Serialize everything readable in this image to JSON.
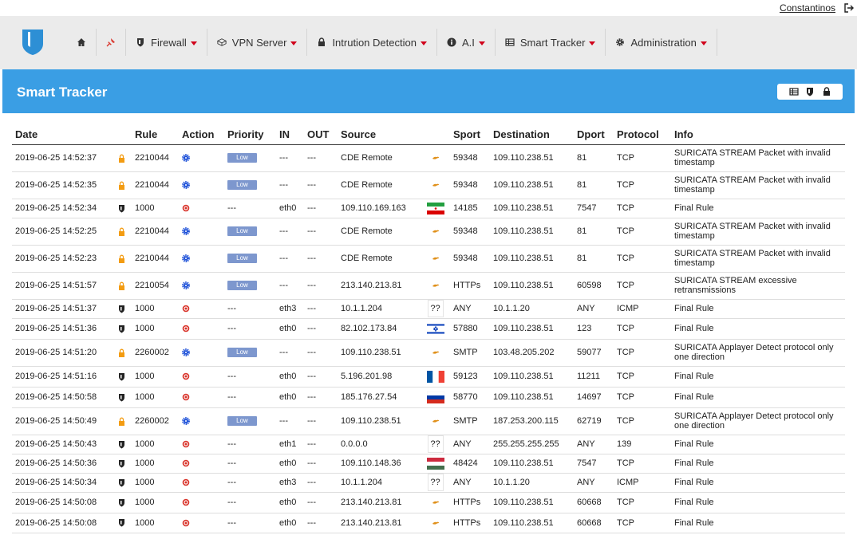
{
  "user": {
    "name": "Constantinos",
    "logout_icon": "sign-out-icon"
  },
  "brand": {
    "icon": "shield-logo",
    "color": "#2d8fd5"
  },
  "nav": [
    {
      "key": "home",
      "label": "",
      "icon": "home-icon",
      "caret": false
    },
    {
      "key": "tools",
      "label": "",
      "icon": "pin-icon",
      "caret": false
    },
    {
      "key": "firewall",
      "label": "Firewall",
      "icon": "shield-icon",
      "caret": true
    },
    {
      "key": "vpn",
      "label": "VPN Server",
      "icon": "cube-icon",
      "caret": true
    },
    {
      "key": "ids",
      "label": "Intrution Detection",
      "icon": "lock-icon",
      "caret": true
    },
    {
      "key": "ai",
      "label": "A.I",
      "icon": "info-icon",
      "caret": true
    },
    {
      "key": "smart",
      "label": "Smart Tracker",
      "icon": "table-icon",
      "caret": true
    },
    {
      "key": "admin",
      "label": "Administration",
      "icon": "gear-icon",
      "caret": true
    }
  ],
  "panel": {
    "title": "Smart Tracker",
    "accent": "#3a9ee4",
    "tools": [
      "table-icon",
      "shield-icon",
      "lock-icon"
    ]
  },
  "columns": [
    "Date",
    "",
    "Rule",
    "Action",
    "Priority",
    "IN",
    "OUT",
    "Source",
    "",
    "Sport",
    "Destination",
    "Dport",
    "Protocol",
    "Info"
  ],
  "rows": [
    {
      "date": "2019-06-25 14:52:37",
      "rtype": "lock",
      "rule": "2210044",
      "action": "alert",
      "priority": "Low",
      "in": "---",
      "out": "---",
      "source": "CDE Remote",
      "flag": "cy",
      "sport": "59348",
      "dest": "109.110.238.51",
      "dport": "81",
      "proto": "TCP",
      "info": "SURICATA STREAM Packet with invalid timestamp"
    },
    {
      "date": "2019-06-25 14:52:35",
      "rtype": "lock",
      "rule": "2210044",
      "action": "alert",
      "priority": "Low",
      "in": "---",
      "out": "---",
      "source": "CDE Remote",
      "flag": "cy",
      "sport": "59348",
      "dest": "109.110.238.51",
      "dport": "81",
      "proto": "TCP",
      "info": "SURICATA STREAM Packet with invalid timestamp"
    },
    {
      "date": "2019-06-25 14:52:34",
      "rtype": "shield",
      "rule": "1000",
      "action": "block",
      "priority": "---",
      "in": "eth0",
      "out": "---",
      "source": "109.110.169.163",
      "flag": "ir",
      "sport": "14185",
      "dest": "109.110.238.51",
      "dport": "7547",
      "proto": "TCP",
      "info": "Final Rule"
    },
    {
      "date": "2019-06-25 14:52:25",
      "rtype": "lock",
      "rule": "2210044",
      "action": "alert",
      "priority": "Low",
      "in": "---",
      "out": "---",
      "source": "CDE Remote",
      "flag": "cy",
      "sport": "59348",
      "dest": "109.110.238.51",
      "dport": "81",
      "proto": "TCP",
      "info": "SURICATA STREAM Packet with invalid timestamp"
    },
    {
      "date": "2019-06-25 14:52:23",
      "rtype": "lock",
      "rule": "2210044",
      "action": "alert",
      "priority": "Low",
      "in": "---",
      "out": "---",
      "source": "CDE Remote",
      "flag": "cy",
      "sport": "59348",
      "dest": "109.110.238.51",
      "dport": "81",
      "proto": "TCP",
      "info": "SURICATA STREAM Packet with invalid timestamp"
    },
    {
      "date": "2019-06-25 14:51:57",
      "rtype": "lock",
      "rule": "2210054",
      "action": "alert",
      "priority": "Low",
      "in": "---",
      "out": "---",
      "source": "213.140.213.81",
      "flag": "cy",
      "sport": "HTTPs",
      "dest": "109.110.238.51",
      "dport": "60598",
      "proto": "TCP",
      "info": "SURICATA STREAM excessive retransmissions"
    },
    {
      "date": "2019-06-25 14:51:37",
      "rtype": "shield",
      "rule": "1000",
      "action": "block",
      "priority": "---",
      "in": "eth3",
      "out": "---",
      "source": "10.1.1.204",
      "flag": "unknown",
      "sport": "ANY",
      "dest": "10.1.1.20",
      "dport": "ANY",
      "proto": "ICMP",
      "info": "Final Rule"
    },
    {
      "date": "2019-06-25 14:51:36",
      "rtype": "shield",
      "rule": "1000",
      "action": "block",
      "priority": "---",
      "in": "eth0",
      "out": "---",
      "source": "82.102.173.84",
      "flag": "il",
      "sport": "57880",
      "dest": "109.110.238.51",
      "dport": "123",
      "proto": "TCP",
      "info": "Final Rule"
    },
    {
      "date": "2019-06-25 14:51:20",
      "rtype": "lock",
      "rule": "2260002",
      "action": "alert",
      "priority": "Low",
      "in": "---",
      "out": "---",
      "source": "109.110.238.51",
      "flag": "cy",
      "sport": "SMTP",
      "dest": "103.48.205.202",
      "dport": "59077",
      "proto": "TCP",
      "info": "SURICATA Applayer Detect protocol only one direction"
    },
    {
      "date": "2019-06-25 14:51:16",
      "rtype": "shield",
      "rule": "1000",
      "action": "block",
      "priority": "---",
      "in": "eth0",
      "out": "---",
      "source": "5.196.201.98",
      "flag": "fr",
      "sport": "59123",
      "dest": "109.110.238.51",
      "dport": "11211",
      "proto": "TCP",
      "info": "Final Rule"
    },
    {
      "date": "2019-06-25 14:50:58",
      "rtype": "shield",
      "rule": "1000",
      "action": "block",
      "priority": "---",
      "in": "eth0",
      "out": "---",
      "source": "185.176.27.54",
      "flag": "ru",
      "sport": "58770",
      "dest": "109.110.238.51",
      "dport": "14697",
      "proto": "TCP",
      "info": "Final Rule"
    },
    {
      "date": "2019-06-25 14:50:49",
      "rtype": "lock",
      "rule": "2260002",
      "action": "alert",
      "priority": "Low",
      "in": "---",
      "out": "---",
      "source": "109.110.238.51",
      "flag": "cy",
      "sport": "SMTP",
      "dest": "187.253.200.115",
      "dport": "62719",
      "proto": "TCP",
      "info": "SURICATA Applayer Detect protocol only one direction"
    },
    {
      "date": "2019-06-25 14:50:43",
      "rtype": "shield",
      "rule": "1000",
      "action": "block",
      "priority": "---",
      "in": "eth1",
      "out": "---",
      "source": "0.0.0.0",
      "flag": "unknown",
      "sport": "ANY",
      "dest": "255.255.255.255",
      "dport": "ANY",
      "proto": "139",
      "info": "Final Rule"
    },
    {
      "date": "2019-06-25 14:50:36",
      "rtype": "shield",
      "rule": "1000",
      "action": "block",
      "priority": "---",
      "in": "eth0",
      "out": "---",
      "source": "109.110.148.36",
      "flag": "hu",
      "sport": "48424",
      "dest": "109.110.238.51",
      "dport": "7547",
      "proto": "TCP",
      "info": "Final Rule"
    },
    {
      "date": "2019-06-25 14:50:34",
      "rtype": "shield",
      "rule": "1000",
      "action": "block",
      "priority": "---",
      "in": "eth3",
      "out": "---",
      "source": "10.1.1.204",
      "flag": "unknown",
      "sport": "ANY",
      "dest": "10.1.1.20",
      "dport": "ANY",
      "proto": "ICMP",
      "info": "Final Rule"
    },
    {
      "date": "2019-06-25 14:50:08",
      "rtype": "shield",
      "rule": "1000",
      "action": "block",
      "priority": "---",
      "in": "eth0",
      "out": "---",
      "source": "213.140.213.81",
      "flag": "cy",
      "sport": "HTTPs",
      "dest": "109.110.238.51",
      "dport": "60668",
      "proto": "TCP",
      "info": "Final Rule"
    },
    {
      "date": "2019-06-25 14:50:08",
      "rtype": "shield",
      "rule": "1000",
      "action": "block",
      "priority": "---",
      "in": "eth0",
      "out": "---",
      "source": "213.140.213.81",
      "flag": "cy",
      "sport": "HTTPs",
      "dest": "109.110.238.51",
      "dport": "60668",
      "proto": "TCP",
      "info": "Final Rule"
    }
  ],
  "unknown_flag_text": "??",
  "colors": {
    "alert": "#1b4fd8",
    "block": "#d9342b",
    "lock": "#f39c12",
    "badge": "#7d97ce"
  }
}
